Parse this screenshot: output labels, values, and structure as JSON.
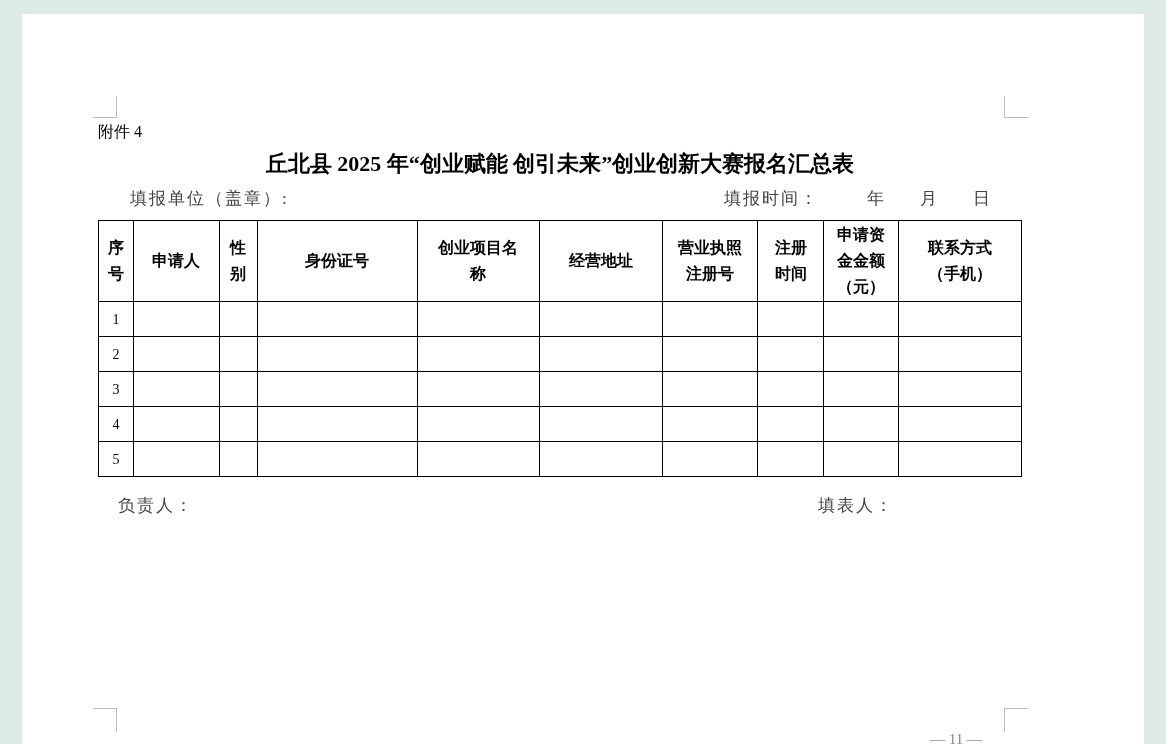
{
  "document": {
    "attachment_label": "附件 4",
    "title": "丘北县 2025 年“创业赋能 创引未来”创业创新大赛报名汇总表",
    "fill_unit_label": "填报单位（盖章）:",
    "fill_time_label": "填报时间：",
    "date_parts": [
      "年",
      "月",
      "日"
    ],
    "table": {
      "columns": [
        {
          "label": "序号"
        },
        {
          "label": "申请人"
        },
        {
          "label": "性别"
        },
        {
          "label": "身份证号"
        },
        {
          "label": "创业项目名称"
        },
        {
          "label": "经营地址"
        },
        {
          "label": "营业执照注册号"
        },
        {
          "label": "注册时间"
        },
        {
          "label": "申请资金金额（元）"
        },
        {
          "label": "联系方式（手机）"
        }
      ],
      "rows": [
        {
          "number": "1"
        },
        {
          "number": "2"
        },
        {
          "number": "3"
        },
        {
          "number": "4"
        },
        {
          "number": "5"
        }
      ]
    },
    "responsible_label": "负责人：",
    "filler_label": "填表人：",
    "page_number": "— 11 —"
  }
}
